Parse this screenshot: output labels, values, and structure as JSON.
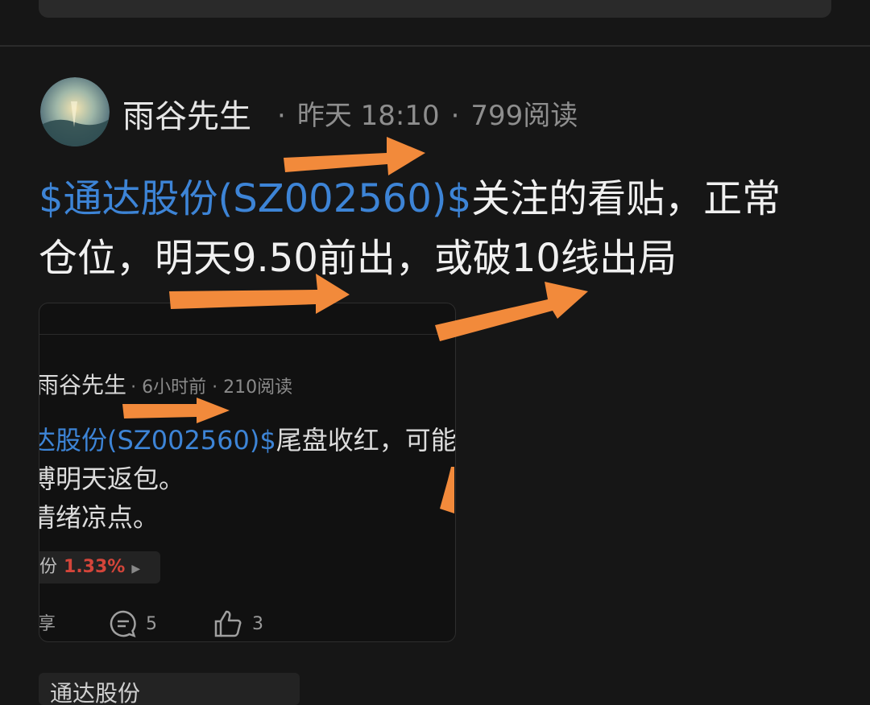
{
  "post": {
    "author": "雨谷先生",
    "separator": "·",
    "time": "昨天 18:10",
    "reads": "799阅读",
    "stock_link": "$通达股份(SZ002560)$",
    "text_line1_rest": "关注的看贴，正常",
    "text_line2": "仓位，明天9.50前出，或破10线出局"
  },
  "quoted": {
    "author": "雨谷先生",
    "time": "6小时前",
    "reads": "210阅读",
    "stock_link": "达股份(SZ002560)$",
    "line1_rest": "尾盘收红，可能",
    "line2": "博明天返包。",
    "line3": "情绪凉点。",
    "tag_name": "份",
    "tag_pct": "1.33%",
    "share_label": "享",
    "comment_count": "5",
    "like_count": "3"
  },
  "bottom_chip": {
    "label": "通达股份"
  },
  "colors": {
    "background": "#161616",
    "link": "#3d84d6",
    "arrow": "#f28a3b",
    "up_red": "#d4453a"
  }
}
